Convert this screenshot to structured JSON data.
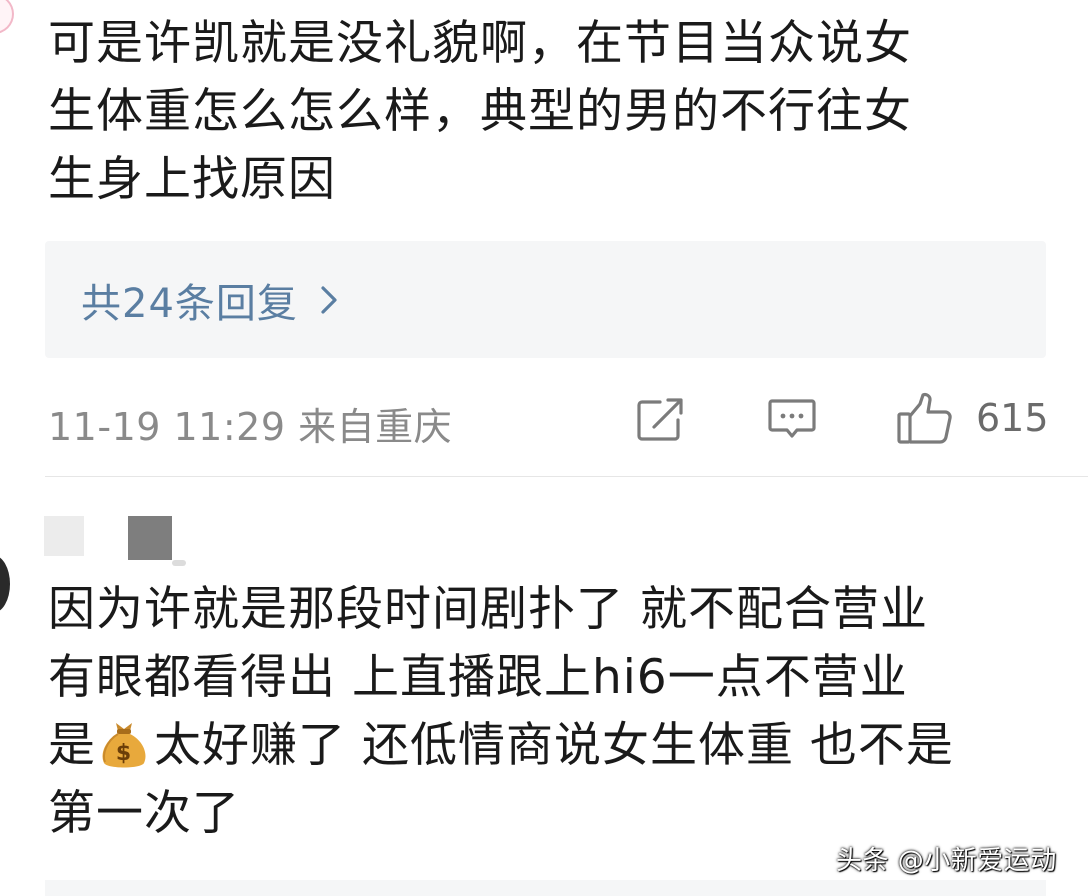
{
  "comment1": {
    "text": "可是许凯就是没礼貌啊，在节目当众说女\n生体重怎么怎么样，典型的男的不行往女\n生身上找原因",
    "reply_link": "共24条回复",
    "timestamp": "11-19 11:29 来自重庆",
    "like_count": "615",
    "icons": {
      "share": "share-icon",
      "comment": "comment-icon",
      "like": "thumbs-up-icon",
      "chevron": "chevron-right-icon"
    }
  },
  "comment2": {
    "text_part1": "因为许就是那段时间剧扑了 就不配合营业\n有眼都看得出 上直播跟上hi6一点不营业\n是",
    "emoji_icon": "money-bag-icon",
    "text_part2": "太好赚了 还低情商说女生体重 也不是\n第一次了"
  },
  "watermark": "头条 @小新爱运动",
  "colors": {
    "link_blue": "#5a7ea2",
    "meta_gray": "#8a8a8a",
    "box_bg": "#f5f6f7"
  }
}
